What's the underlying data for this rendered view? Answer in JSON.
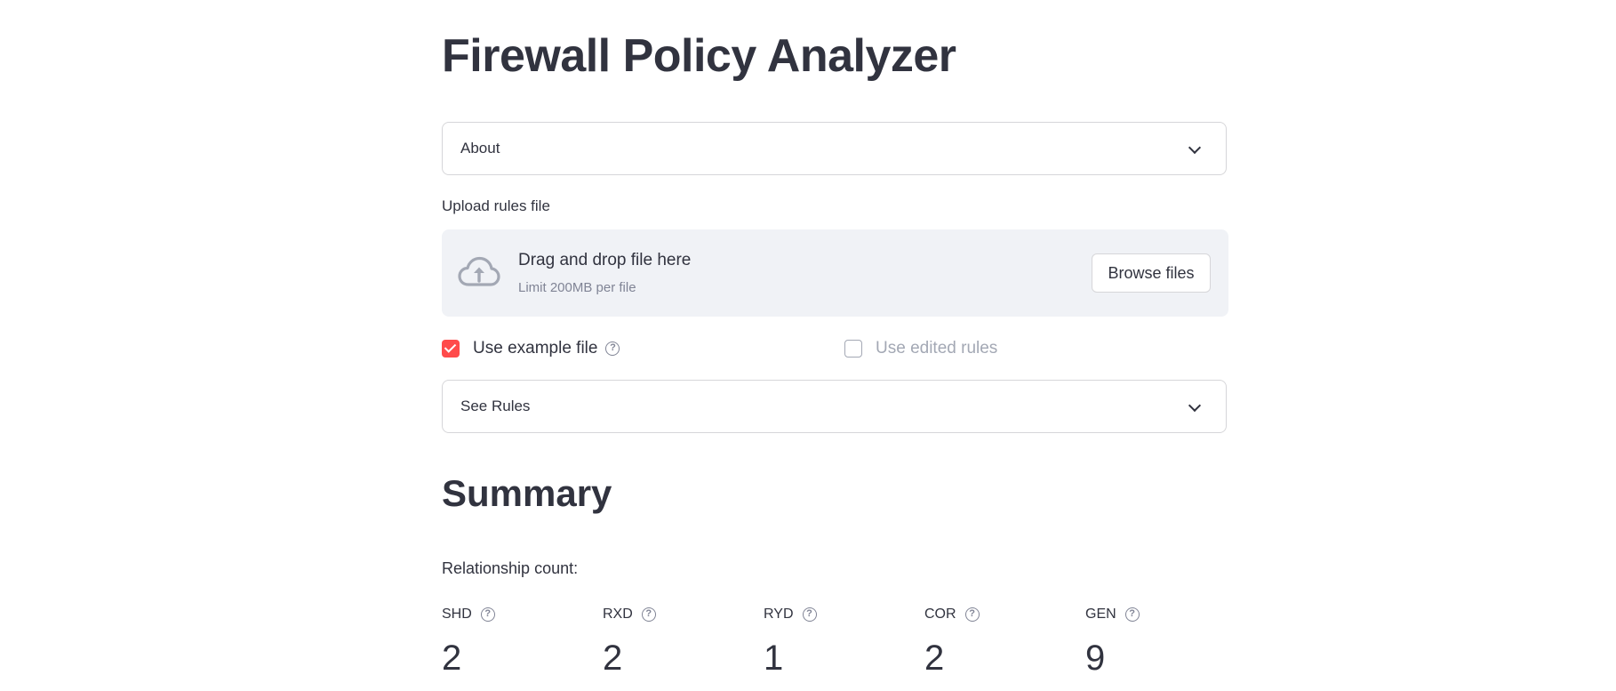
{
  "page": {
    "title": "Firewall Policy Analyzer"
  },
  "about_expander": {
    "label": "About"
  },
  "uploader": {
    "label": "Upload rules file",
    "drop_text": "Drag and drop file here",
    "limit_text": "Limit 200MB per file",
    "browse_label": "Browse files",
    "icon": "cloud-upload-icon"
  },
  "options": {
    "use_example": {
      "label": "Use example file",
      "checked": true
    },
    "use_edited": {
      "label": "Use edited rules",
      "checked": false,
      "disabled": true
    }
  },
  "rules_expander": {
    "label": "See Rules"
  },
  "summary": {
    "title": "Summary",
    "relationship_label": "Relationship count:",
    "metrics": [
      {
        "label": "SHD",
        "value": "2"
      },
      {
        "label": "RXD",
        "value": "2"
      },
      {
        "label": "RYD",
        "value": "1"
      },
      {
        "label": "COR",
        "value": "2"
      },
      {
        "label": "GEN",
        "value": "9"
      }
    ]
  },
  "colors": {
    "accent": "#ff4b4b",
    "text": "#31333f",
    "muted": "#808495",
    "dropzone_bg": "#f0f2f6",
    "border": "#d6d6d9"
  }
}
